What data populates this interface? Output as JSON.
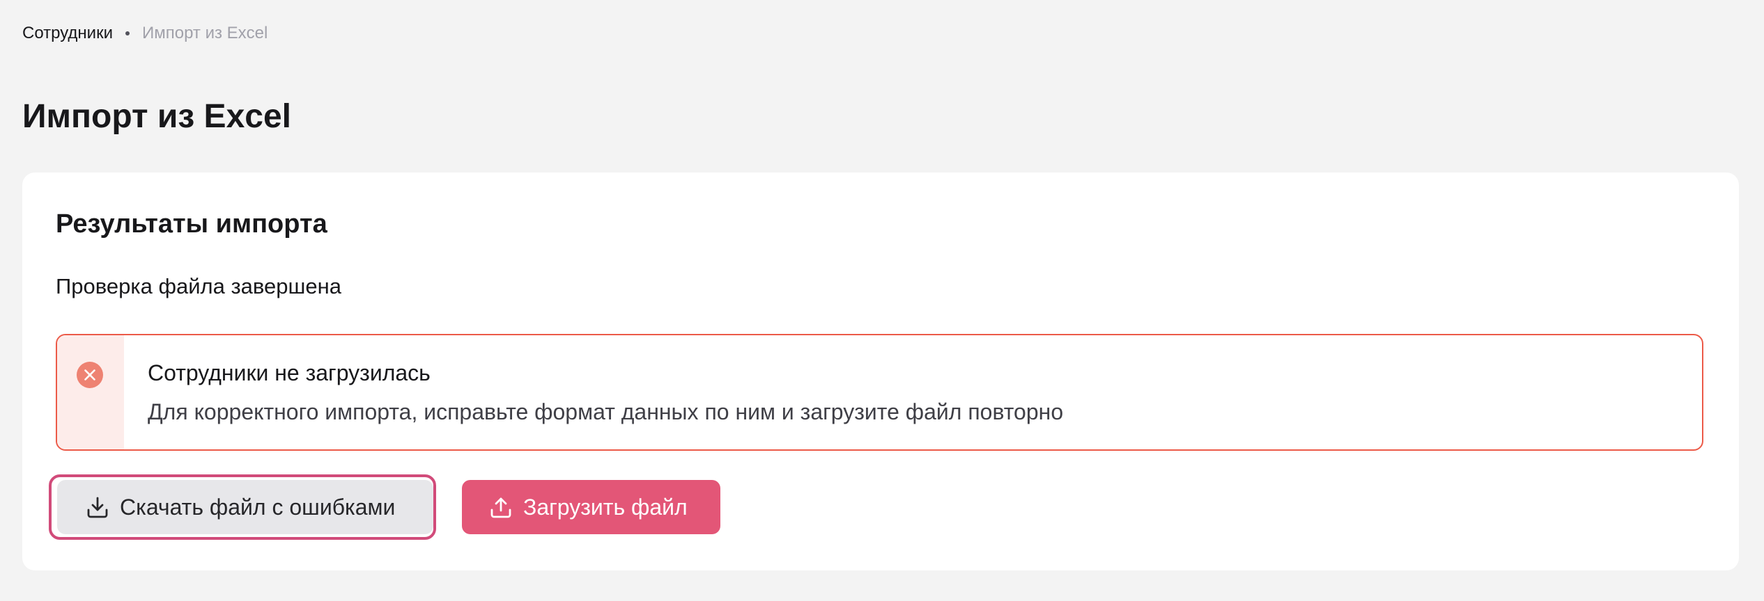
{
  "breadcrumb": {
    "items": [
      {
        "label": "Сотрудники"
      },
      {
        "label": "Импорт из Excel"
      }
    ]
  },
  "page": {
    "title": "Импорт из Excel"
  },
  "card": {
    "title": "Результаты импорта",
    "status": "Проверка файла завершена"
  },
  "alert": {
    "icon": "error-circle-icon",
    "color": "#ec5a48",
    "title": "Сотрудники не загрузилась",
    "text": "Для корректного импорта, исправьте формат данных по ним и загрузите файл повторно"
  },
  "actions": {
    "download_errors_label": "Скачать файл с ошибками",
    "download_icon": "download-icon",
    "upload_label": "Загрузить файл",
    "upload_icon": "upload-icon",
    "primary_color": "#e35677",
    "focus_ring_color": "#d14b7a"
  }
}
